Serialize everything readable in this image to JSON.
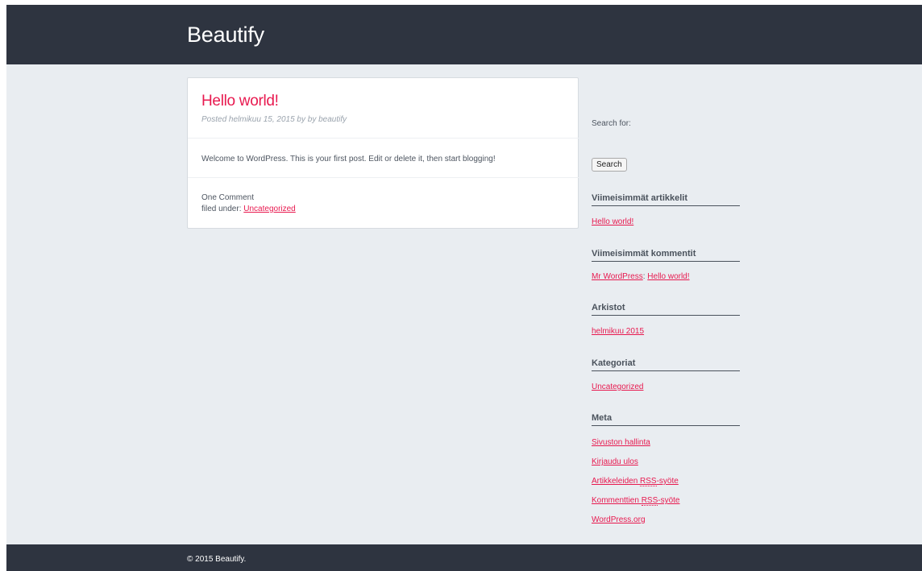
{
  "header": {
    "site_title": "Beautify"
  },
  "post": {
    "title": "Hello world!",
    "meta": "Posted helmikuu 15, 2015 by by beautify",
    "body": "Welcome to WordPress. This is your first post. Edit or delete it, then start blogging!",
    "comments": "One Comment",
    "filed_under_label": "filed under: ",
    "category": "Uncategorized"
  },
  "sidebar": {
    "search_label": "Search for:",
    "search_button": "Search",
    "recent_posts": {
      "title": "Viimeisimmät artikkelit",
      "items": [
        "Hello world!"
      ]
    },
    "recent_comments": {
      "title": "Viimeisimmät kommentit",
      "author": "Mr WordPress",
      "separator": ": ",
      "post": "Hello world!"
    },
    "archives": {
      "title": "Arkistot",
      "items": [
        "helmikuu 2015"
      ]
    },
    "categories": {
      "title": "Kategoriat",
      "items": [
        "Uncategorized"
      ]
    },
    "meta": {
      "title": "Meta",
      "items": {
        "site_admin": "Sivuston hallinta",
        "logout": "Kirjaudu ulos",
        "entries_rss_prefix": "Artikkeleiden ",
        "entries_rss_abbr": "RSS",
        "entries_rss_suffix": "-syöte",
        "comments_rss_prefix": "Kommenttien ",
        "comments_rss_abbr": "RSS",
        "comments_rss_suffix": "-syöte",
        "wordpress_org": "WordPress.org"
      }
    }
  },
  "footer": {
    "copyright": "© 2015 Beautify."
  },
  "colors": {
    "header_bg": "#2e3440",
    "page_bg": "#e9edf1",
    "accent": "#e8194f"
  }
}
